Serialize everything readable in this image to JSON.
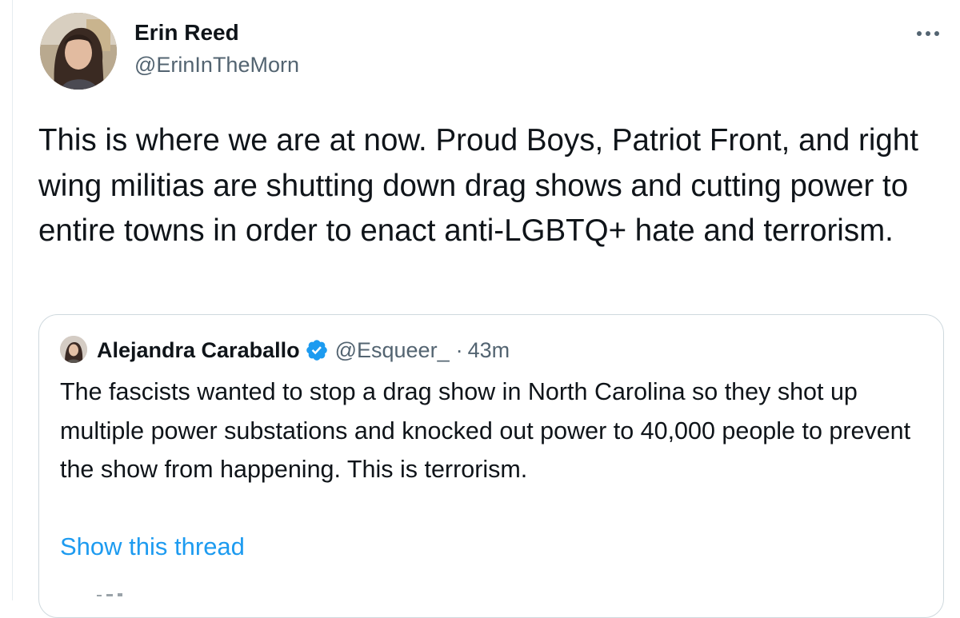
{
  "tweet": {
    "author_name": "Erin Reed",
    "author_handle": "@ErinInTheMorn",
    "more_icon": "more-horizontal-icon",
    "text": "This is where we are at now. Proud Boys, Patriot Front, and right wing militias are shutting down drag shows and cutting power to entire towns in order to enact anti-LGBTQ+ hate and terrorism."
  },
  "quote": {
    "author_name": "Alejandra Caraballo",
    "verified_icon": "verified-badge-icon",
    "author_handle": "@Esqueer_",
    "separator": "·",
    "time": "43m",
    "text": "The fascists wanted to stop a drag show in North Carolina so they shot up multiple power substations and knocked out power to 40,000 people to prevent the show from happening. This is terrorism.",
    "show_thread_label": "Show this thread"
  },
  "colors": {
    "text_primary": "#0f1419",
    "text_secondary": "#536471",
    "link": "#1d9bf0",
    "border": "#cfd9de",
    "verified": "#1d9bf0"
  }
}
